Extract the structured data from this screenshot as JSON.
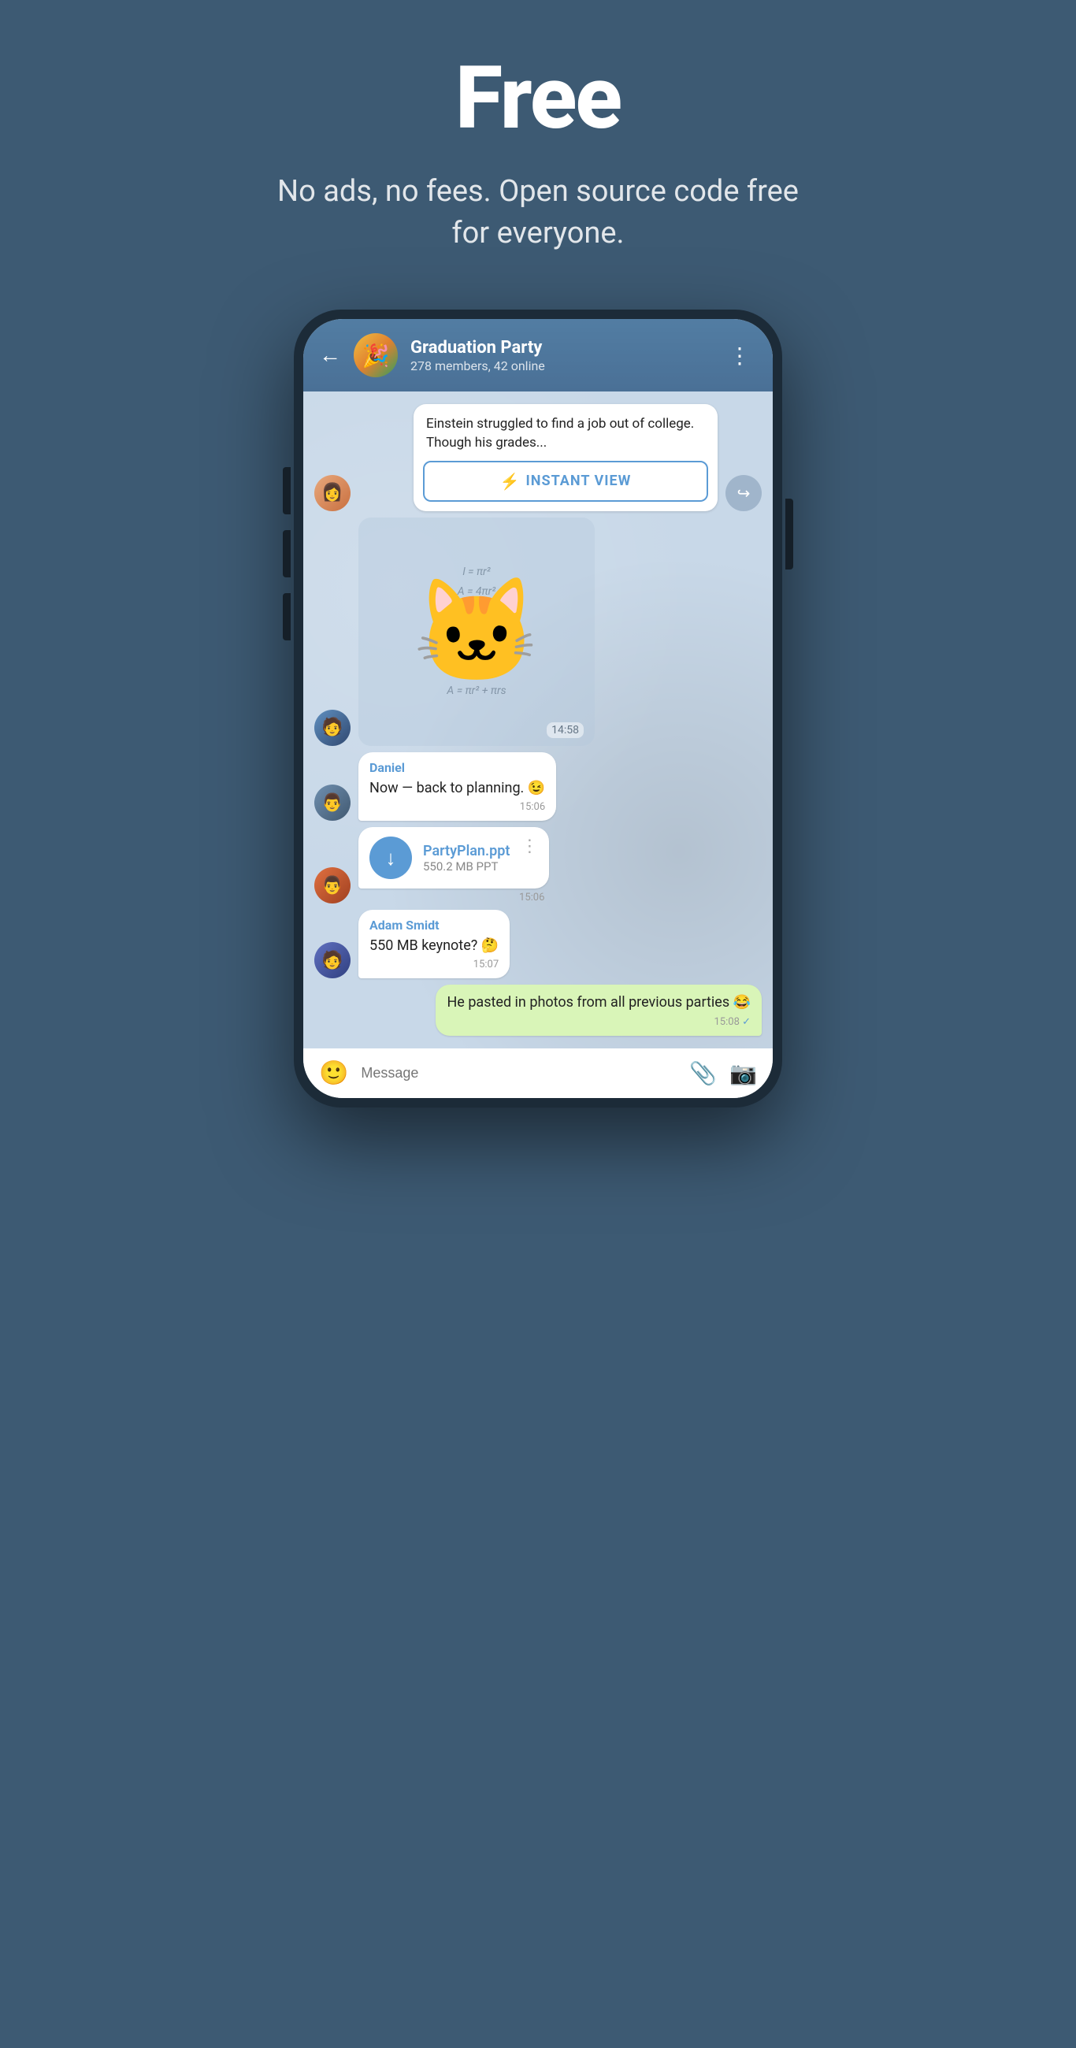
{
  "hero": {
    "title": "Free",
    "subtitle": "No ads, no fees. Open source code free for everyone."
  },
  "chat": {
    "back_label": "←",
    "group_name": "Graduation Party",
    "group_meta": "278 members, 42 online",
    "menu_icon": "⋮",
    "article_text": "Einstein struggled to find a job out of college. Though his grades...",
    "instant_view_label": "INSTANT VIEW",
    "sticker_time": "14:58",
    "messages": [
      {
        "id": "daniel-msg",
        "sender": "Daniel",
        "text": "Now — back to planning. 😉",
        "time": "15:06",
        "outgoing": false
      },
      {
        "id": "file-msg",
        "file_name": "PartyPlan.ppt",
        "file_size": "550.2 MB PPT",
        "time": "15:06",
        "outgoing": false
      },
      {
        "id": "adam-msg",
        "sender": "Adam Smidt",
        "text": "550 MB keynote? 🤔",
        "time": "15:07",
        "outgoing": false
      },
      {
        "id": "outgoing-msg",
        "text": "He pasted in photos from all previous parties 😂",
        "time": "15:08",
        "outgoing": true
      }
    ],
    "input_placeholder": "Message"
  }
}
